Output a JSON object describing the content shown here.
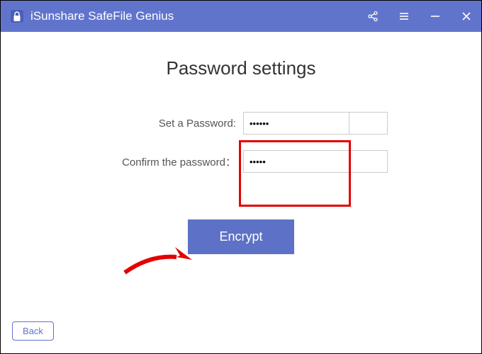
{
  "app": {
    "title": "iSunshare SafeFile Genius"
  },
  "main": {
    "heading": "Password settings",
    "password_label": "Set a Password:",
    "password_value": "••••••",
    "confirm_label": "Confirm the password：",
    "confirm_value": "•••••",
    "encrypt_label": "Encrypt"
  },
  "footer": {
    "back_label": "Back"
  },
  "colors": {
    "accent": "#6174cc",
    "highlight": "#e30000"
  }
}
